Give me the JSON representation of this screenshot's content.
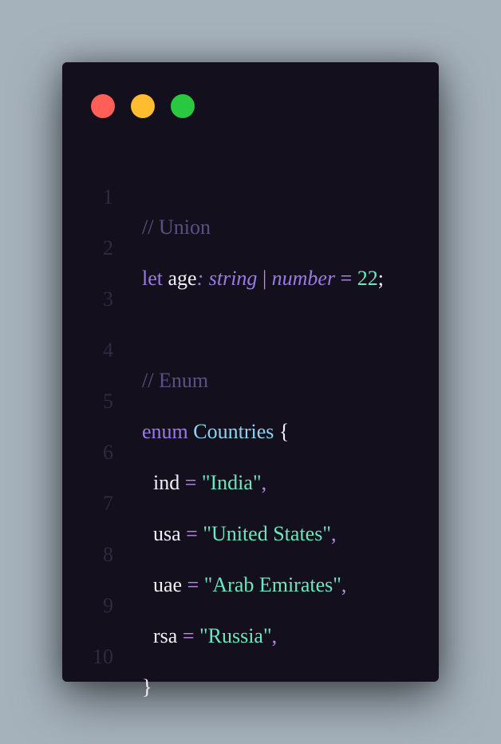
{
  "window": {
    "controls": [
      "close",
      "minimize",
      "maximize"
    ]
  },
  "colors": {
    "background": "#a5b1bb",
    "editor": "#130f1c",
    "close": "#ff5f57",
    "minimize": "#febc2e",
    "maximize": "#28c840"
  },
  "code": {
    "line_numbers": [
      "1",
      "2",
      "3",
      "4",
      "5",
      "6",
      "7",
      "8",
      "9",
      "10"
    ],
    "l1": {
      "comment": "// Union"
    },
    "l2": {
      "kw": "let",
      "ident": " age",
      "colon_type": ": string",
      "pipe": " | ",
      "type2": "number",
      "eq": " = ",
      "num": "22",
      "semi": ";"
    },
    "l4": {
      "comment": "// Enum"
    },
    "l5": {
      "kw": "enum",
      "name": " Countries",
      "brace": " {"
    },
    "l6": {
      "key": "ind",
      "eq": " = ",
      "val": "\"India\"",
      "comma": ","
    },
    "l7": {
      "key": "usa",
      "eq": " = ",
      "val": "\"United States\"",
      "comma": ","
    },
    "l8": {
      "key": "uae",
      "eq": " = ",
      "val": "\"Arab Emirates\"",
      "comma": ","
    },
    "l9": {
      "key": "rsa",
      "eq": " = ",
      "val": "\"Russia\"",
      "comma": ","
    },
    "l10": {
      "brace": "}"
    }
  }
}
